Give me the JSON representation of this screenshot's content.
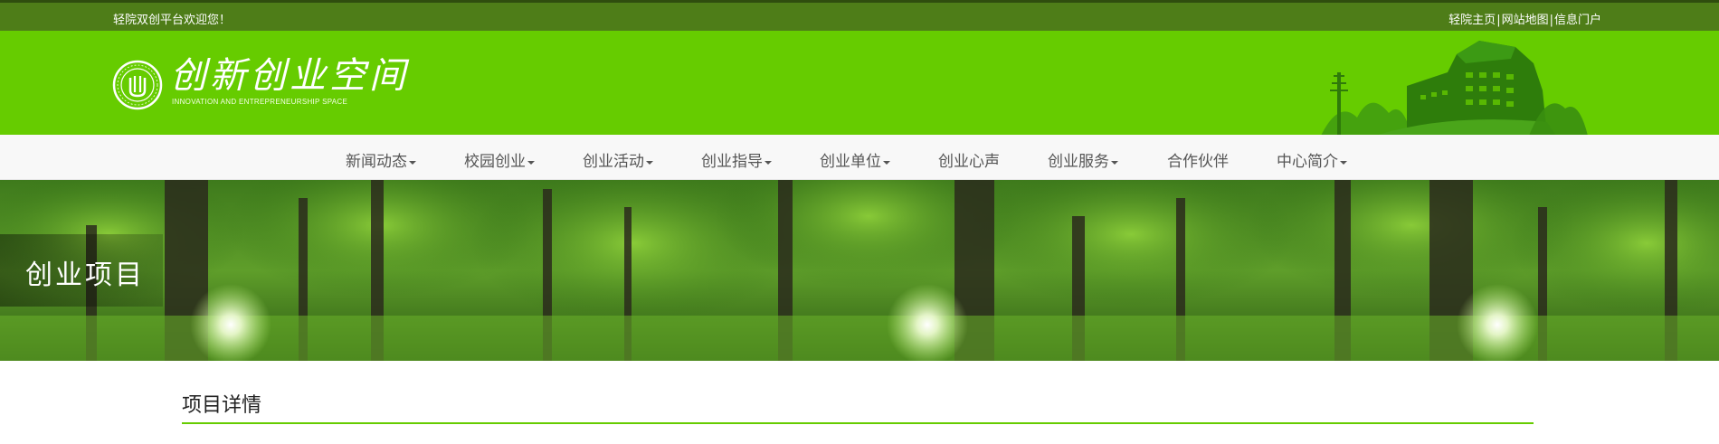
{
  "topbar": {
    "welcome": "轻院双创平台欢迎您！",
    "links": [
      "轻院主页",
      "网站地图",
      "信息门户"
    ],
    "separator": "|"
  },
  "header": {
    "logo_title": "创新创业空间",
    "logo_subtitle": "INNOVATION AND  ENTREPRENEURSHIP SPACE"
  },
  "nav": {
    "items": [
      {
        "label": "新闻动态",
        "dropdown": true
      },
      {
        "label": "校园创业",
        "dropdown": true
      },
      {
        "label": "创业活动",
        "dropdown": true
      },
      {
        "label": "创业指导",
        "dropdown": true
      },
      {
        "label": "创业单位",
        "dropdown": true
      },
      {
        "label": "创业心声",
        "dropdown": false
      },
      {
        "label": "创业服务",
        "dropdown": true
      },
      {
        "label": "合作伙伴",
        "dropdown": false
      },
      {
        "label": "中心简介",
        "dropdown": true
      }
    ]
  },
  "banner": {
    "title": "创业项目"
  },
  "main": {
    "section_title": "项目详情"
  },
  "colors": {
    "topbar": "#4e7d18",
    "header": "#66cc00",
    "nav_bg": "#f8f8f8",
    "accent": "#66cc00"
  },
  "icons": [
    "school-emblem-icon",
    "campus-building-illustration",
    "caret-down-icon"
  ]
}
